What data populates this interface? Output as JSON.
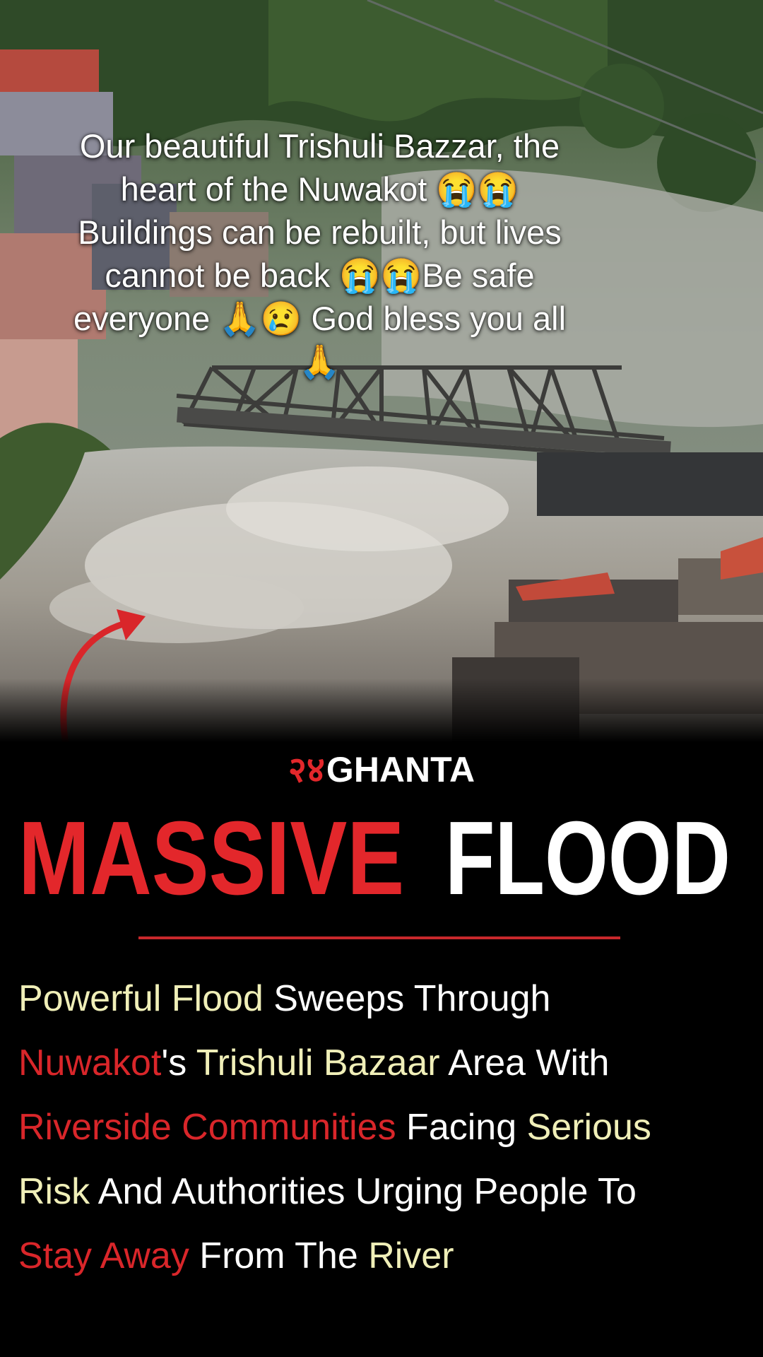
{
  "caption": {
    "text": "Our beautiful Trishuli Bazzar, the heart of the Nuwakot 😭😭 Buildings can be rebuilt, but lives cannot be back 😭😭Be safe everyone 🙏😢 God bless you all 🙏"
  },
  "news_card": {
    "brand_mark": "२४",
    "brand_name": "GHANTA",
    "headline_red": "MASSIVE",
    "headline_white": "FLOOD",
    "lines": [
      [
        {
          "t": "Powerful Flood",
          "c": "y"
        },
        {
          "t": " Sweeps Through",
          "c": "w"
        }
      ],
      [
        {
          "t": "Nuwakot",
          "c": "r"
        },
        {
          "t": "'s ",
          "c": "w"
        },
        {
          "t": "Trishuli Bazaar",
          "c": "y"
        },
        {
          "t": " Area With",
          "c": "w"
        }
      ],
      [
        {
          "t": "Riverside Communities",
          "c": "r"
        },
        {
          "t": " Facing ",
          "c": "w"
        },
        {
          "t": "Serious",
          "c": "y"
        }
      ],
      [
        {
          "t": "Risk",
          "c": "y"
        },
        {
          "t": " And Authorities Urging People To",
          "c": "w"
        }
      ],
      [
        {
          "t": "Stay Away",
          "c": "r"
        },
        {
          "t": " From The ",
          "c": "w"
        },
        {
          "t": "River",
          "c": "y"
        }
      ]
    ]
  },
  "colors": {
    "accent_red": "#e3272b",
    "highlight_yellow": "#f0efb8",
    "background": "#000000"
  }
}
